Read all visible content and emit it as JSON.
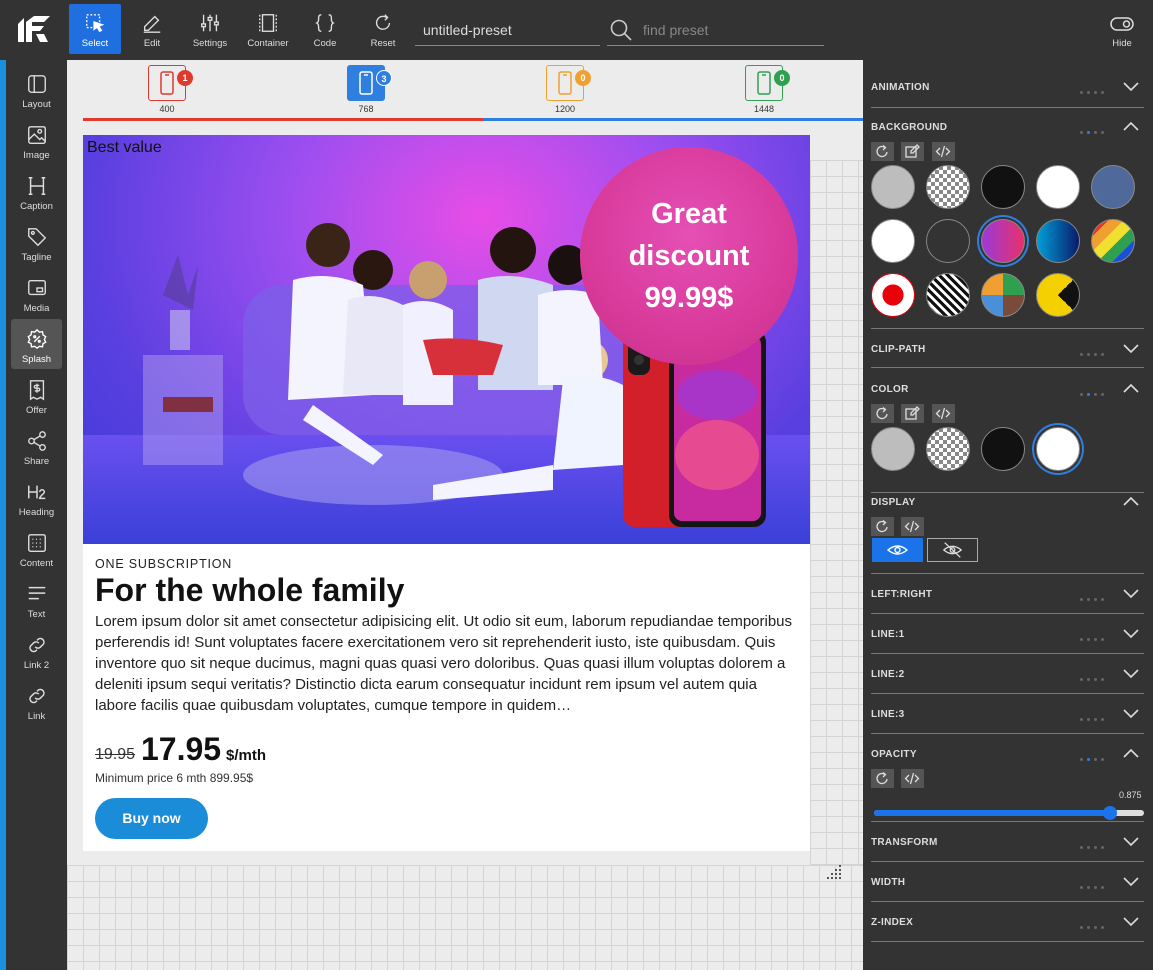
{
  "toolbar": {
    "tools": [
      {
        "label": "Select",
        "icon": "select-icon"
      },
      {
        "label": "Edit",
        "icon": "edit-icon"
      },
      {
        "label": "Settings",
        "icon": "settings-icon"
      },
      {
        "label": "Container",
        "icon": "container-icon"
      },
      {
        "label": "Code",
        "icon": "code-icon"
      },
      {
        "label": "Reset",
        "icon": "reset-icon"
      }
    ],
    "preset_name": "untitled-preset",
    "search_placeholder": "find preset",
    "hide_label": "Hide"
  },
  "sidebar": {
    "items": [
      {
        "label": "Layout",
        "icon": "layout-icon"
      },
      {
        "label": "Image",
        "icon": "image-icon"
      },
      {
        "label": "Caption",
        "icon": "caption-icon"
      },
      {
        "label": "Tagline",
        "icon": "tag-icon"
      },
      {
        "label": "Media",
        "icon": "media-icon"
      },
      {
        "label": "Splash",
        "icon": "splash-icon"
      },
      {
        "label": "Offer",
        "icon": "offer-icon"
      },
      {
        "label": "Share",
        "icon": "share-icon"
      },
      {
        "label": "Heading",
        "icon": "heading-icon"
      },
      {
        "label": "Content",
        "icon": "content-icon"
      },
      {
        "label": "Text",
        "icon": "text-icon"
      },
      {
        "label": "Link 2",
        "icon": "link-icon"
      },
      {
        "label": "Link",
        "icon": "link-icon"
      }
    ],
    "active": "Splash"
  },
  "breakpoints": [
    {
      "label": "400",
      "count": "1",
      "color": "#e03a2f"
    },
    {
      "label": "768",
      "count": "3",
      "color": "#2f7fe0"
    },
    {
      "label": "1200",
      "count": "0",
      "color": "#f0a030"
    },
    {
      "label": "1448",
      "count": "0",
      "color": "#2fa050"
    }
  ],
  "preview": {
    "hero_label": "Best value",
    "splash_line1": "Great",
    "splash_line2": "discount",
    "splash_line3": "99.99$",
    "eyebrow": "ONE SUBSCRIPTION",
    "title": "For the whole family",
    "body": "Lorem ipsum dolor sit amet consectetur adipisicing elit. Ut odio sit eum, laborum repudiandae temporibus perferendis id! Sunt voluptates facere exercitationem vero sit reprehenderit iusto, iste quibusdam. Quis inventore quo sit neque ducimus, magni quas quasi vero doloribus. Quas quasi illum voluptas dolorem a deleniti ipsum sequi veritatis? Distinctio dicta earum consequatur incidunt rem ipsum vel autem quia labore facilis quae quibusdam voluptates, cumque tempore in quidem…",
    "price_old": "19.95",
    "price_new": "17.95",
    "price_unit": "$/mth",
    "price_min": "Minimum price 6 mth 899.95$",
    "button": "Buy now"
  },
  "panel": {
    "sections": {
      "animation": "ANIMATION",
      "background": "BACKGROUND",
      "clip_path": "CLIP-PATH",
      "color": "COLOR",
      "display": "DISPLAY",
      "left_right": "LEFT:RIGHT",
      "line1": "LINE:1",
      "line2": "LINE:2",
      "line3": "LINE:3",
      "opacity": "OPACITY",
      "transform": "TRANSFORM",
      "width": "WIDTH",
      "z_index": "Z-INDEX"
    },
    "opacity_value": 0.875,
    "opacity_label": "0.875"
  },
  "colors": {
    "accent": "#2f7fe0",
    "buy_button": "#1a8cd8",
    "splash": "#d83a9a"
  }
}
